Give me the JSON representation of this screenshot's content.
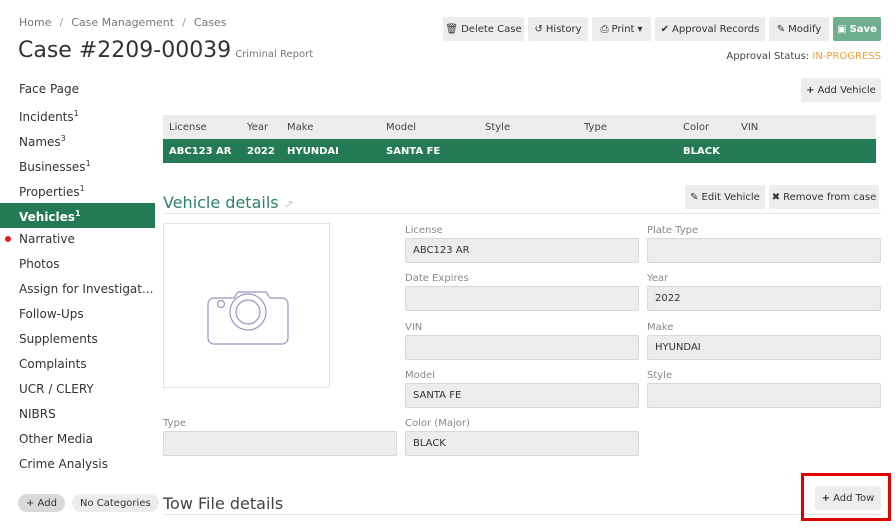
{
  "breadcrumb": [
    "Home",
    "Case Management",
    "Cases"
  ],
  "title": "Case #2209-00039",
  "subtitle": "Criminal Report",
  "toolbar": {
    "delete": "Delete Case",
    "history": "History",
    "print": "Print",
    "approval": "Approval Records",
    "modify": "Modify",
    "save": "Save"
  },
  "approval": {
    "label": "Approval Status:",
    "value": "IN-PROGRESS"
  },
  "sidebar": [
    {
      "label": "Face Page"
    },
    {
      "label": "Incidents",
      "count": "1"
    },
    {
      "label": "Names",
      "count": "3"
    },
    {
      "label": "Businesses",
      "count": "1"
    },
    {
      "label": "Properties",
      "count": "1"
    },
    {
      "label": "Vehicles",
      "count": "1"
    },
    {
      "label": "Narrative"
    },
    {
      "label": "Photos"
    },
    {
      "label": "Assign for Investigat..."
    },
    {
      "label": "Follow-Ups"
    },
    {
      "label": "Supplements"
    },
    {
      "label": "Complaints"
    },
    {
      "label": "UCR / CLERY"
    },
    {
      "label": "NIBRS"
    },
    {
      "label": "Other Media"
    },
    {
      "label": "Crime Analysis"
    }
  ],
  "sidebar_footer": {
    "add": "+ Add",
    "categories": "No Categories"
  },
  "add_vehicle": "Add Vehicle",
  "table": {
    "headers": [
      "License",
      "Year",
      "Make",
      "Model",
      "Style",
      "Type",
      "Color",
      "VIN"
    ],
    "rows": [
      [
        "ABC123 AR",
        "2022",
        "HYUNDAI",
        "SANTA FE",
        "",
        "",
        "BLACK",
        ""
      ]
    ]
  },
  "vehicle_details": {
    "title": "Vehicle details",
    "edit": "Edit Vehicle",
    "remove": "Remove from case",
    "fields": {
      "license": {
        "label": "License",
        "value": "ABC123 AR"
      },
      "plate_type": {
        "label": "Plate Type",
        "value": ""
      },
      "date_expires": {
        "label": "Date Expires",
        "value": ""
      },
      "year": {
        "label": "Year",
        "value": "2022"
      },
      "vin": {
        "label": "VIN",
        "value": ""
      },
      "make": {
        "label": "Make",
        "value": "HYUNDAI"
      },
      "model": {
        "label": "Model",
        "value": "SANTA FE"
      },
      "style": {
        "label": "Style",
        "value": ""
      },
      "type": {
        "label": "Type",
        "value": ""
      },
      "color": {
        "label": "Color (Major)",
        "value": "BLACK"
      }
    }
  },
  "tow": {
    "title": "Tow File details",
    "add": "Add Tow"
  },
  "colors": {
    "accent": "#247a55",
    "status": "#f0a030",
    "highlight": "#e00000"
  }
}
